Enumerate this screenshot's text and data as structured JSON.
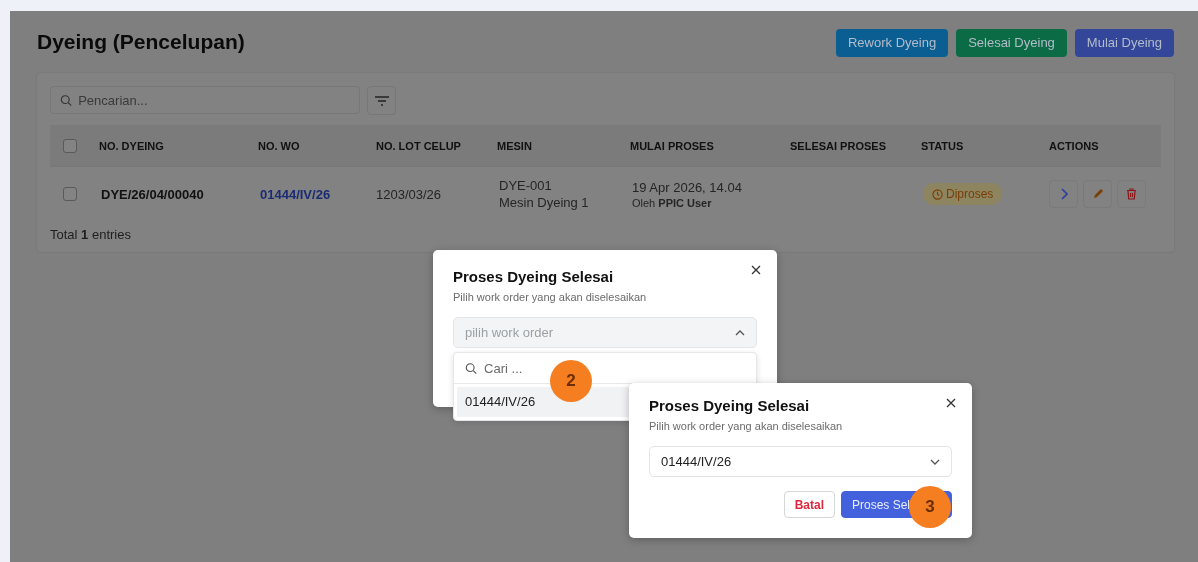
{
  "page": {
    "title": "Dyeing (Pencelupan)",
    "actions": [
      {
        "label": "Rework Dyeing",
        "color": "#0b5e92"
      },
      {
        "label": "Selesai Dyeing",
        "color": "#0a6b45"
      },
      {
        "label": "Mulai Dyeing",
        "color": "#33469a"
      }
    ]
  },
  "search": {
    "placeholder": "Pencarian..."
  },
  "table": {
    "select_all": {
      "checked": false
    },
    "columns": [
      "NO. DYEING",
      "NO. WO",
      "NO. LOT CELUP",
      "MESIN",
      "MULAI PROSES",
      "SELESAI PROSES",
      "STATUS",
      "ACTIONS"
    ],
    "rows": [
      {
        "checked": false,
        "no_dyeing": "DYE/26/04/00040",
        "no_wo": "01444/IV/26",
        "no_lot": "1203/03/26",
        "machine_code": "DYE-001",
        "machine_name": "Mesin Dyeing 1",
        "started": "19 Apr 2026, 14.04",
        "started_by": "Oleh **PPIC User**",
        "status": "Diproses"
      }
    ],
    "total": "Total **1** entries"
  },
  "dialogs": [
    {
      "title": "Proses Dyeing Selesai",
      "subtitle": "Pilih work order yang akan diselesaikan",
      "select": {
        "placeholder": "pilih work order",
        "expanded": true
      },
      "dropdown": {
        "search_placeholder": "Cari ...",
        "options": [
          {
            "label": "01444/IV/26",
            "selected": true
          }
        ]
      }
    },
    {
      "title": "Proses Dyeing Selesai",
      "subtitle": "Pilih work order yang akan diselesaikan",
      "select": {
        "value": "01444/IV/26",
        "expanded": false
      },
      "buttons": [
        {
          "label": "Batal",
          "kind": "cancel"
        },
        {
          "label": "Proses Sel",
          "kind": "primary"
        }
      ]
    }
  ],
  "steps": [
    "2",
    "3"
  ]
}
